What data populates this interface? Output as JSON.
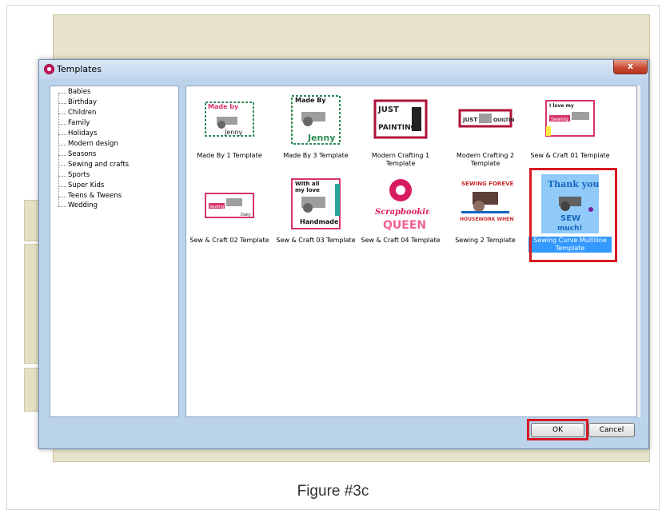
{
  "dialog": {
    "title": "Templates",
    "close_label": "x"
  },
  "categories": [
    "Babies",
    "Birthday",
    "Children",
    "Family",
    "Holidays",
    "Modern design",
    "Seasons",
    "Sewing and crafts",
    "Sports",
    "Super Kids",
    "Teens & Tweens",
    "Wedding"
  ],
  "templates": [
    {
      "label": "Made By 1 Template",
      "thumb_text": "Made by\nJenny",
      "accent": "#2e8b57"
    },
    {
      "label": "Made By 3 Template",
      "thumb_text": "Made By\nJenny",
      "accent": "#2e8b57"
    },
    {
      "label": "Modern Crafting 1 Template",
      "thumb_text": "JUST\nPAINTING",
      "accent": "#b0123a"
    },
    {
      "label": "Modern Crafting 2 Template",
      "thumb_text": "JUST QUILTING",
      "accent": "#b0123a"
    },
    {
      "label": "Sew & Craft 01 Template",
      "thumb_text": "Sewing",
      "accent": "#d6336c"
    },
    {
      "label": "Sew & Craft 02 Template",
      "thumb_text": "Sewing",
      "accent": "#d6336c"
    },
    {
      "label": "Sew & Craft 03 Template",
      "thumb_text": "With all my love\nHandmade",
      "accent": "#d6336c"
    },
    {
      "label": "Sew & Craft 04 Template",
      "thumb_text": "Scrapbooking\nQUEEN",
      "accent": "#d81b60"
    },
    {
      "label": "Sewing 2 Template",
      "thumb_text": "SEWING FOREVER\nHOUSEWORK WHENEVER",
      "accent": "#c62828"
    },
    {
      "label": "Sewing Curve Multiline Template",
      "thumb_text": "Thank you\nSEW\nmuch!",
      "accent": "#1565c0"
    }
  ],
  "buttons": {
    "ok": "OK",
    "cancel": "Cancel"
  },
  "caption": "Figure #3c"
}
